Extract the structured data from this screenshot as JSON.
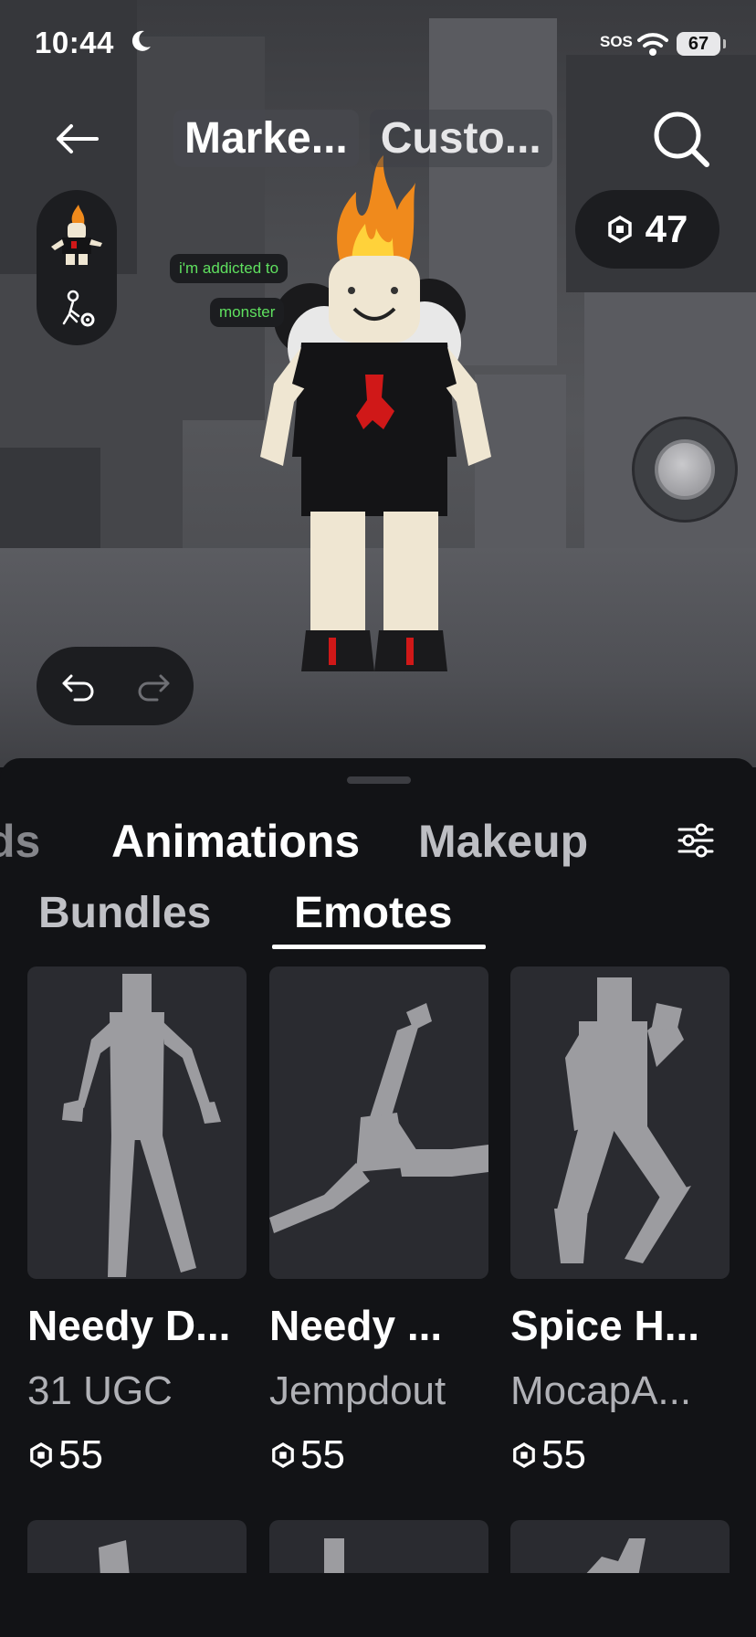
{
  "status_bar": {
    "time": "10:44",
    "sos": "SOS",
    "battery": "67"
  },
  "header": {
    "tabs": [
      {
        "label": "Marke...",
        "active": true
      },
      {
        "label": "Custo...",
        "active": false
      }
    ]
  },
  "robux_balance": "47",
  "chat_bubbles": [
    "i'm addicted to",
    "monster"
  ],
  "categories": {
    "partial_label": "ds",
    "items": [
      {
        "label": "Animations",
        "active": true
      },
      {
        "label": "Makeup",
        "active": false
      }
    ]
  },
  "subtabs": [
    {
      "label": "Bundles",
      "active": false
    },
    {
      "label": "Emotes",
      "active": true
    }
  ],
  "items": [
    {
      "name": "Needy D...",
      "creator": "31 UGC",
      "price": "55",
      "thumbnail": "dance-pose-icon"
    },
    {
      "name": "Needy ...",
      "creator": "Jempdout",
      "price": "55",
      "thumbnail": "kick-pose-icon"
    },
    {
      "name": "Spice H...",
      "creator": "MocapA...",
      "price": "55",
      "thumbnail": "jump-pose-icon"
    }
  ],
  "colors": {
    "background": "#121316",
    "card": "#2a2b30",
    "chat_text": "#5fe05f",
    "pill": "#1c1d20"
  }
}
